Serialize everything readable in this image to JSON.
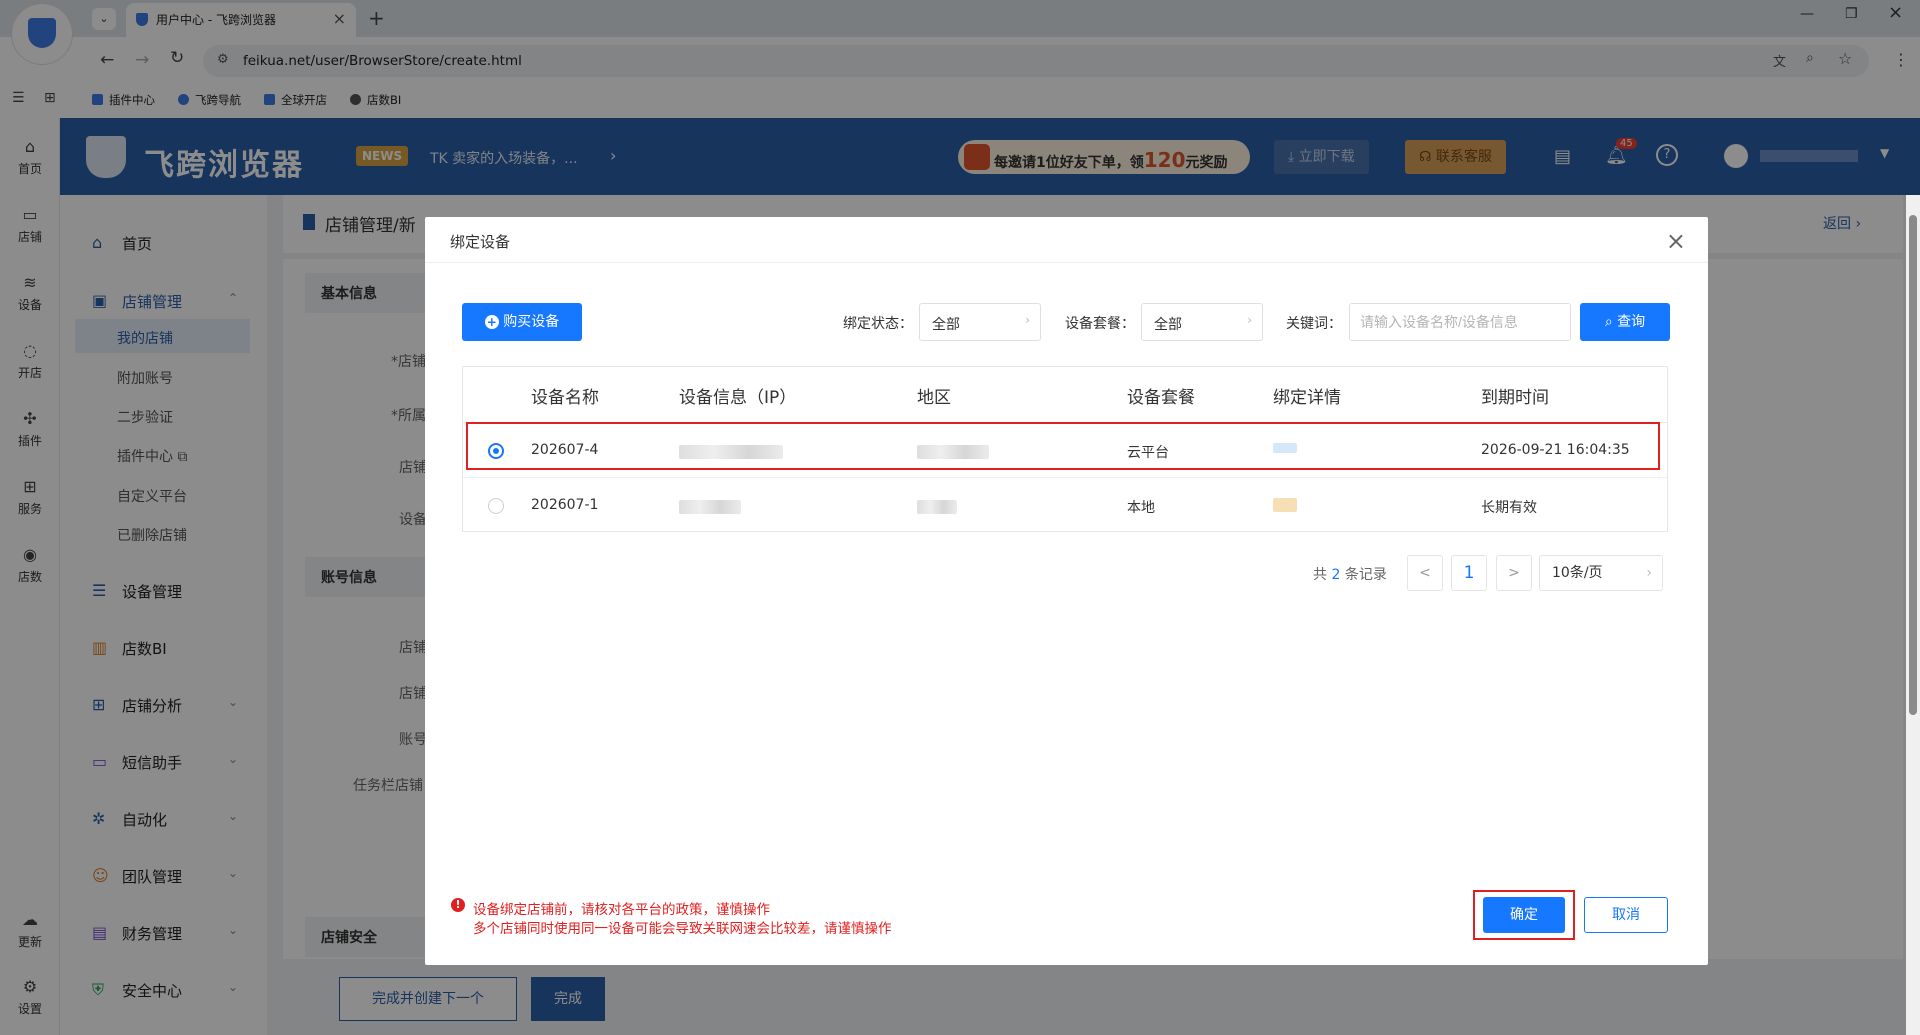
{
  "browser": {
    "tab_title": "用户中心 - 飞跨浏览器",
    "url": "feikua.net/user/BrowserStore/create.html",
    "bookmarks": [
      "插件中心",
      "飞跨导航",
      "全球开店",
      "店数BI"
    ]
  },
  "rail": {
    "items": [
      "首页",
      "店铺",
      "设备",
      "开店",
      "插件",
      "服务",
      "店数"
    ],
    "bottom": [
      "更新",
      "设置"
    ]
  },
  "header": {
    "logo": "飞跨浏览器",
    "news_badge": "NEWS",
    "news_text": "TK 卖家的入场装备，...",
    "promo_a": "每邀请1位好友下单，领",
    "promo_num": "120",
    "promo_b": "元奖励",
    "download": "立即下载",
    "support": "联系客服",
    "notif_count": "45"
  },
  "menu": {
    "home": "首页",
    "store_mgmt": "店铺管理",
    "subs": [
      "我的店铺",
      "附加账号",
      "二步验证",
      "插件中心",
      "自定义平台",
      "已删除店铺"
    ],
    "items": [
      "设备管理",
      "店数BI",
      "店铺分析",
      "短信助手",
      "自动化",
      "团队管理",
      "财务管理",
      "安全中心"
    ]
  },
  "content": {
    "breadcrumb": "店铺管理/新",
    "back": "返回",
    "sec_basic": "基本信息",
    "sec_account": "账号信息",
    "sec_security": "店铺安全",
    "field_labels": [
      "*店铺",
      "*所属",
      "店铺",
      "设备"
    ],
    "account_labels": [
      "店铺",
      "店铺",
      "账号",
      "任务栏店铺"
    ],
    "btn_next": "完成并创建下一个",
    "btn_done": "完成"
  },
  "dialog": {
    "title": "绑定设备",
    "buy_button": "购买设备",
    "filter_status_label": "绑定状态：",
    "filter_status_value": "全部",
    "filter_plan_label": "设备套餐：",
    "filter_plan_value": "全部",
    "keyword_label": "关键词：",
    "keyword_placeholder": "请输入设备名称/设备信息",
    "search_button": "查询",
    "columns": [
      "设备名称",
      "设备信息（IP）",
      "地区",
      "设备套餐",
      "绑定详情",
      "到期时间"
    ],
    "rows": [
      {
        "name": "202607-4",
        "plan": "云平台",
        "expiry": "2026-09-21 16:04:35",
        "selected": true
      },
      {
        "name": "202607-1",
        "plan": "本地",
        "expiry": "长期有效",
        "selected": false
      }
    ],
    "pagination": {
      "total_prefix": "共",
      "total": "2",
      "total_suffix": "条记录",
      "current_page": "1",
      "page_size": "10条/页",
      "prev": "<",
      "next": ">"
    },
    "warning_line1": "设备绑定店铺前，请核对各平台的政策，谨慎操作",
    "warning_line2": "多个店铺同时使用同一设备可能会导致关联网速会比较差，请谨慎操作",
    "confirm": "确定",
    "cancel": "取消"
  }
}
